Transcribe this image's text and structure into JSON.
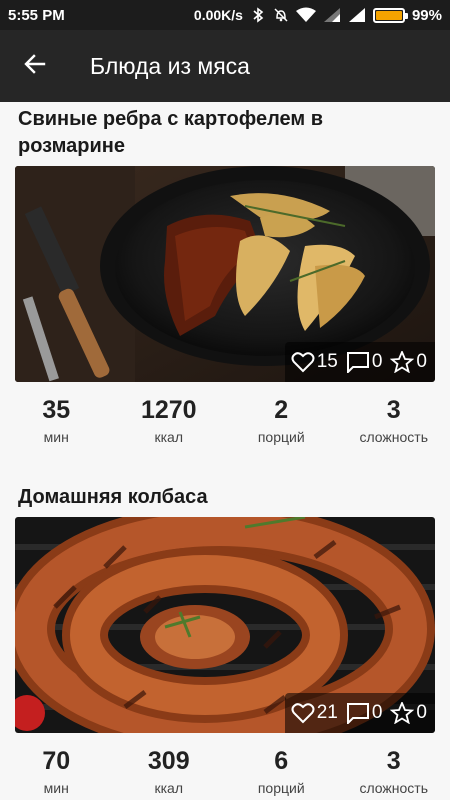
{
  "status": {
    "time": "5:55 PM",
    "speed": "0.00K/s",
    "battery": "99%",
    "icons": [
      "bluetooth-icon",
      "alarm-off-icon",
      "wifi-icon",
      "signal-icon",
      "signal-icon",
      "battery-icon"
    ],
    "battery_color": "#f5a300"
  },
  "appbar": {
    "title": "Блюда из мяса",
    "back_icon": "arrow-back-icon"
  },
  "recipes": [
    {
      "title": "Свиные ребра с картофелем в розмарине",
      "likes": "15",
      "comments": "0",
      "favorites": "0",
      "stats": [
        {
          "value": "35",
          "label": "мин"
        },
        {
          "value": "1270",
          "label": "ккал"
        },
        {
          "value": "2",
          "label": "порций"
        },
        {
          "value": "3",
          "label": "сложность"
        }
      ]
    },
    {
      "title": "Домашняя колбаса",
      "likes": "21",
      "comments": "0",
      "favorites": "0",
      "stats": [
        {
          "value": "70",
          "label": "мин"
        },
        {
          "value": "309",
          "label": "ккал"
        },
        {
          "value": "6",
          "label": "порций"
        },
        {
          "value": "3",
          "label": "сложность"
        }
      ]
    }
  ]
}
